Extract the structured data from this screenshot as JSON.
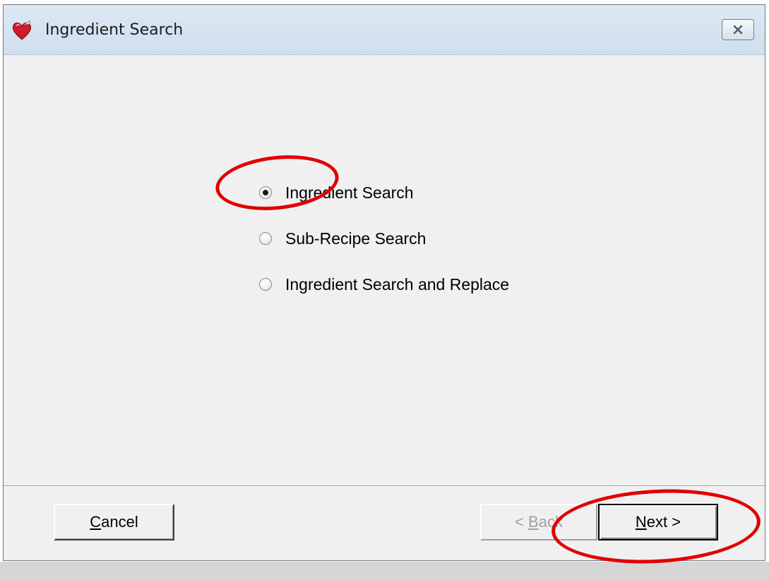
{
  "window": {
    "title": "Ingredient Search",
    "close_glyph": "✕",
    "icon": "heart-icon"
  },
  "options": [
    {
      "label": "Ingredient Search",
      "checked": true
    },
    {
      "label": "Sub-Recipe Search",
      "checked": false
    },
    {
      "label": "Ingredient Search and Replace",
      "checked": false
    }
  ],
  "buttons": {
    "cancel": {
      "mnemonic": "C",
      "rest": "ancel"
    },
    "back": {
      "prefix": "< ",
      "mnemonic": "B",
      "rest": "ack",
      "enabled": false
    },
    "next": {
      "mnemonic": "N",
      "rest": "ext >",
      "enabled": true
    }
  },
  "colors": {
    "annotation": "#e00000",
    "titlebar": "#dde8f3",
    "dialog_bg": "#f0f0f0"
  }
}
